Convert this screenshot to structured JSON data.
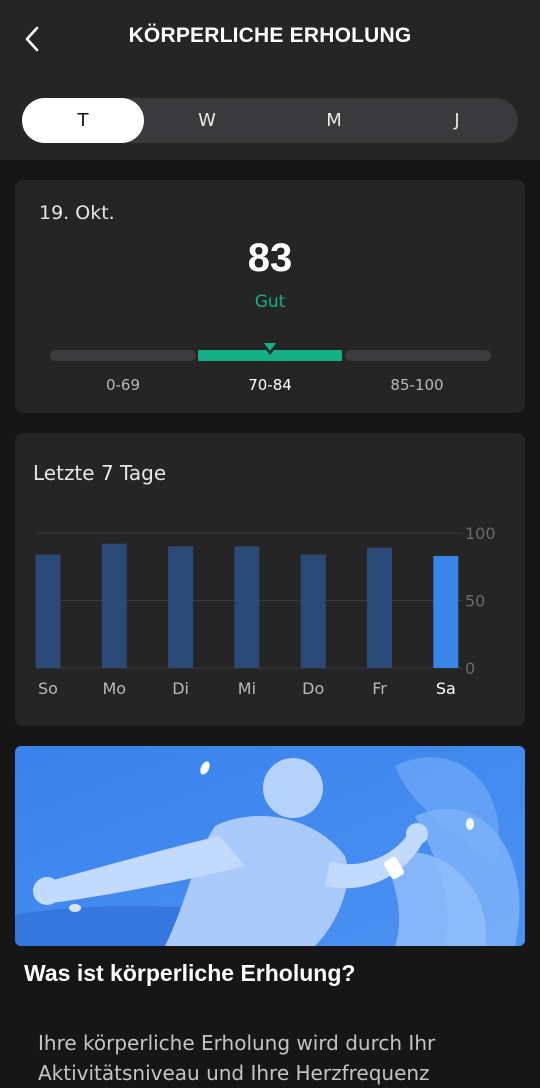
{
  "header": {
    "title": "KÖRPERLICHE ERHOLUNG",
    "tabs": [
      {
        "label": "T",
        "active": true
      },
      {
        "label": "W",
        "active": false
      },
      {
        "label": "M",
        "active": false
      },
      {
        "label": "J",
        "active": false
      }
    ]
  },
  "summary": {
    "date": "19. Okt.",
    "score": "83",
    "rating": "Gut",
    "ranges": [
      "0-69",
      "70-84",
      "85-100"
    ],
    "active_range": "70-84"
  },
  "chart_data": {
    "type": "bar",
    "title": "Letzte 7 Tage",
    "categories": [
      "So",
      "Mo",
      "Di",
      "Mi",
      "Do",
      "Fr",
      "Sa"
    ],
    "values": [
      84,
      92,
      90,
      90,
      84,
      89,
      83
    ],
    "ylim": [
      0,
      100
    ],
    "yticks": [
      "100",
      "50",
      "0"
    ],
    "highlight_index": 6,
    "bar_color": "#2b4a75",
    "highlight_color": "#3a86e8",
    "grid": true
  },
  "info": {
    "title": "Was ist körperliche Erholung?",
    "body": "Ihre körperliche Erholung wird durch Ihr Aktivitätsniveau und Ihre Herzfrequenz"
  },
  "colors": {
    "accent_green": "#14b087",
    "banner_blue": "#3c86ec"
  },
  "icons": {
    "back": "chevron-left-icon"
  }
}
